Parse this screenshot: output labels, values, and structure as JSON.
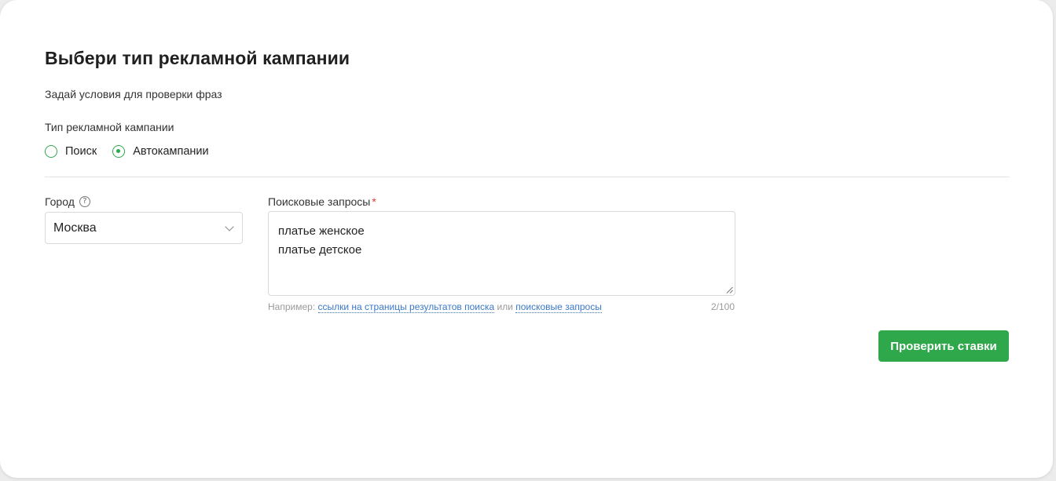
{
  "form": {
    "title": "Выбери тип рекламной кампании",
    "subtitle": "Задай условия для проверки фраз",
    "campaign_type_label": "Тип рекламной кампании",
    "campaign_types": [
      {
        "label": "Поиск",
        "checked": false
      },
      {
        "label": "Автокампании",
        "checked": true
      }
    ],
    "city": {
      "label": "Город",
      "help_icon": "question-circle-icon",
      "help_glyph": "?",
      "value": "Москва"
    },
    "queries": {
      "label": "Поисковые запросы",
      "required_mark": "*",
      "lines": [
        "платье женское",
        "платье детское"
      ],
      "hint_prefix": "Например:",
      "hint_link1": "ссылки на страницы результатов поиска",
      "hint_or": "или",
      "hint_link2": "поисковые запросы",
      "counter": "2/100"
    },
    "submit_label": "Проверить ставки"
  },
  "colors": {
    "accent": "#2ea84b",
    "link": "#3a78c9",
    "required": "#e53935"
  }
}
